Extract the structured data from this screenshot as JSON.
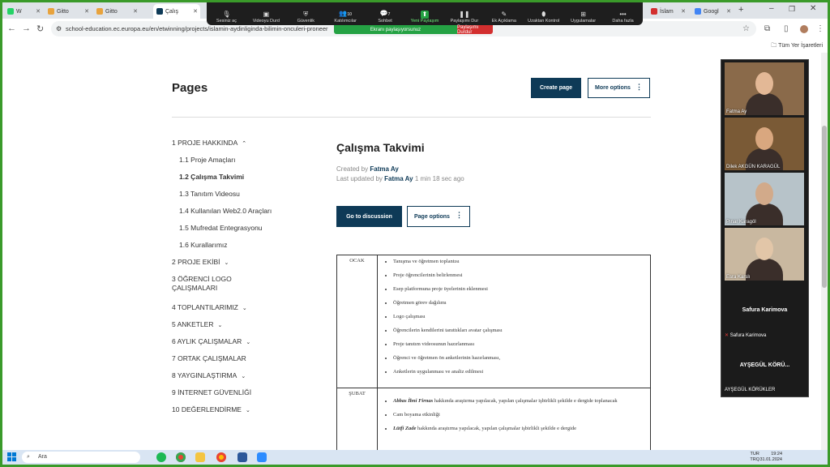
{
  "browser": {
    "tabs": [
      {
        "label": "W",
        "color": "#25d366"
      },
      {
        "label": "Gitto",
        "color": "#e8a33d"
      },
      {
        "label": "Gitto",
        "color": "#e8a33d"
      },
      {
        "label": "Çalış",
        "color": "#0e3a57"
      },
      {
        "label": "İslam",
        "color": "#d32f2f"
      },
      {
        "label": "Googl",
        "color": "#4285f4"
      }
    ],
    "url": "school-education.ec.europa.eu/en/etwinning/projects/islamin-aydinliginda-bilimin-onculeri-proneer",
    "bookmarks_all": "Tüm Yer İşaretleri"
  },
  "meeting": {
    "toolbar": [
      {
        "label": "Sesiniz aç",
        "icon": "mic-icon"
      },
      {
        "label": "Videoyu Durd",
        "icon": "camera-icon"
      },
      {
        "label": "Güvenlik",
        "icon": "shield-icon"
      },
      {
        "label": "Katılımcılar",
        "icon": "people-icon",
        "badge": "10"
      },
      {
        "label": "Sohbet",
        "icon": "chat-icon",
        "badge": "7"
      },
      {
        "label": "Yeni Paylaşım",
        "icon": "share-icon",
        "active": true
      },
      {
        "label": "Paylaşımı Dur",
        "icon": "pause-icon"
      },
      {
        "label": "Ek Açıklama",
        "icon": "pen-icon"
      },
      {
        "label": "Uzaktan Kontrol",
        "icon": "mouse-icon"
      },
      {
        "label": "Uygulamalar",
        "icon": "apps-icon"
      },
      {
        "label": "Daha fazla",
        "icon": "more-icon"
      }
    ],
    "share_status": "Ekranı paylaşıyorsunuz",
    "stop_share": "Paylaşımı Durdur",
    "participants": [
      {
        "name": "Fatma Ay",
        "bg": "#8a6a4a",
        "face": "#e3b896"
      },
      {
        "name": "Dilek AKGÜN KARAGÜL",
        "bg": "#7a5a36",
        "face": "#d9a77f"
      },
      {
        "name": "Pınar Karagöl",
        "bg": "#b7c3c9",
        "face": "#d2aa8a"
      },
      {
        "name": "Esra Karslı",
        "bg": "#c9b8a0",
        "face": "#e2c6a8"
      }
    ],
    "audio_only": [
      {
        "title": "Safura Karimova",
        "sub": "Safura Karimova"
      },
      {
        "title": "AYŞEGÜL KÖRÜ...",
        "sub": "AYŞEGÜL KÖRÜKLER"
      }
    ]
  },
  "page": {
    "heading": "Pages",
    "create_page": "Create page",
    "more_options": "More options",
    "nav": [
      {
        "label": "1  PROJE HAKKINDA",
        "chev": "⌃",
        "indent": false
      },
      {
        "label": "1.1  Proje Amaçları",
        "indent": true
      },
      {
        "label": "1.2  Çalışma Takvimi",
        "indent": true,
        "selected": true
      },
      {
        "label": "1.3  Tanıtım Videosu",
        "indent": true
      },
      {
        "label": "1.4  Kullanılan Web2.0 Araçları",
        "indent": true
      },
      {
        "label": "1.5  Mufredat Entegrasyonu",
        "indent": true
      },
      {
        "label": "1.6  Kurallarımız",
        "indent": true
      },
      {
        "label": "2  PROJE EKİBİ",
        "chev": "⌄",
        "indent": false
      },
      {
        "label": "3  ÖĞRENCİ LOGO ÇALIŞMALARI",
        "indent": false,
        "multiline": true
      },
      {
        "label": "4  TOPLANTILARIMIZ",
        "chev": "⌄",
        "indent": false
      },
      {
        "label": "5  ANKETLER",
        "chev": "⌄",
        "indent": false
      },
      {
        "label": "6  AYLIK ÇALIŞMALAR",
        "chev": "⌄",
        "indent": false
      },
      {
        "label": "7  ORTAK ÇALIŞMALAR",
        "indent": false
      },
      {
        "label": "8  YAYGINLAŞTIRMA",
        "chev": "⌄",
        "indent": false
      },
      {
        "label": "9  İNTERNET GÜVENLİĞİ",
        "indent": false
      },
      {
        "label": "10  DEĞERLENDİRME",
        "chev": "⌄",
        "indent": false
      }
    ],
    "article_title": "Çalışma Takvimi",
    "created_prefix": "Created by",
    "created_by": "Fatma Ay",
    "updated_prefix": "Last updated by",
    "updated_by": "Fatma Ay",
    "updated_ago": "1 min 18 sec ago",
    "go_discussion": "Go to discussion",
    "page_options": "Page options",
    "schedule": [
      {
        "month": "OCAK",
        "items": [
          "Tanışma ve öğretmen toplantısı",
          "Proje öğrencilerinin belirlenmesi",
          "Esep platformuna proje üyelerinin eklenmesi",
          "Öğretmen görev dağılımı",
          "Logo çalışması",
          "Öğrencilerin kendilerini tanıttıkları avatar çalışması",
          "Proje tanıtım videosunun hazırlanması",
          "Öğrenci ve öğretmen ön anketlerinin hazırlanması,",
          "Anketlerin uygulanması ve analiz edilmesi"
        ]
      },
      {
        "month": "ŞUBAT",
        "items": [
          {
            "em": "Abbas İbni Firnas",
            "text": "  hakkında araştırma yapılacak, yapılan çalışmalar işbirlikli şekilde e dergide toplanacak"
          },
          {
            "em": "",
            "text": "Cam boyama etkinliği"
          },
          {
            "em": "Lütfi Zade",
            "text": "  hakkında araştırma yapılacak, yapılan çalışmalar işbirlikli şekilde e dergide"
          }
        ]
      }
    ]
  },
  "taskbar": {
    "search": "Ara",
    "lang_top": "TUR",
    "lang_bottom": "TRQ",
    "time": "19:24",
    "date": "31.01.2024"
  }
}
